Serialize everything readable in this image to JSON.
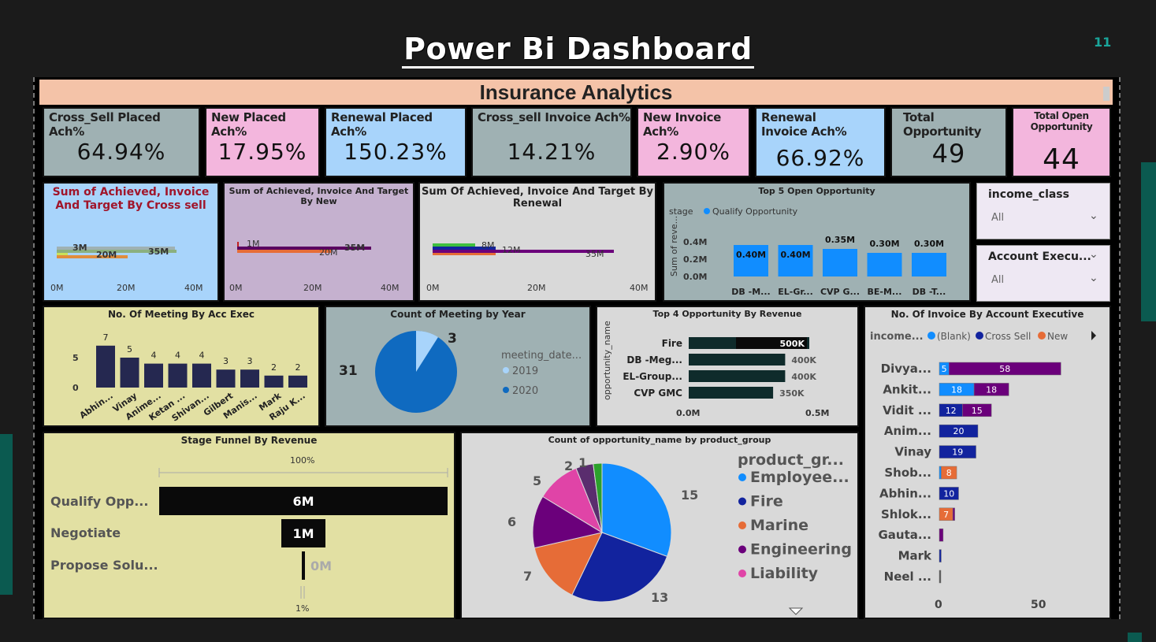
{
  "slide": {
    "title": "Power Bi Dashboard",
    "page_number": "11"
  },
  "header": {
    "title": "Insurance Analytics"
  },
  "kpis": [
    {
      "label": "Cross_Sell Placed Ach%",
      "value": "64.94%",
      "color": "#9fb1b3"
    },
    {
      "label": "New Placed Ach%",
      "value": "17.95%",
      "color": "#f3b6dd"
    },
    {
      "label": "Renewal Placed Ach%",
      "value": "150.23%",
      "color": "#a8d4fb"
    },
    {
      "label": "Cross_sell Invoice Ach%",
      "value": "14.21%",
      "color": "#9fb1b3"
    },
    {
      "label": "New Invoice Ach%",
      "value": "2.90%",
      "color": "#f3b6dd"
    },
    {
      "label": "Renewal Invoice Ach%",
      "value": "66.92%",
      "color": "#a8d4fb"
    },
    {
      "label": "Total Opportunity",
      "value": "49",
      "color": "#9fb1b3"
    },
    {
      "label": "Total Open Opportunity",
      "value": "44",
      "color": "#f3b6dd"
    }
  ],
  "charts": {
    "cross_sell": {
      "title": "Sum of Achieved, Invoice And Target By Cross sell",
      "bar_labels": [
        "3M",
        "20M",
        "35M"
      ],
      "axis": [
        "0M",
        "20M",
        "40M"
      ]
    },
    "new": {
      "title": "Sum of Achieved, Invoice And Target By New",
      "bar_labels": [
        "1M",
        "20M",
        "35M"
      ],
      "axis": [
        "0M",
        "20M",
        "40M"
      ]
    },
    "renewal": {
      "title": "Sum Of Achieved, Invoice And Target By Renewal",
      "bar_labels": [
        "8M",
        "12M",
        "35M"
      ],
      "axis": [
        "0M",
        "20M",
        "40M"
      ]
    },
    "top5": {
      "title": "Top 5 Open Opportunity",
      "legend_label": "stage",
      "legend_item": "Qualify Opportunity",
      "y_axis_title": "Sum of reve...",
      "y_ticks": [
        "0.4M",
        "0.2M",
        "0.0M"
      ],
      "categories": [
        "DB -M...",
        "EL-Gr...",
        "CVP G...",
        "BE-M...",
        "DB -T..."
      ],
      "labels": [
        "0.40M",
        "0.40M",
        "0.35M",
        "0.30M",
        "0.30M"
      ]
    },
    "meetings_exec": {
      "title": "No. Of Meeting By Acc Exec",
      "y_ticks": [
        "5",
        "0"
      ],
      "categories": [
        "Abhin...",
        "Vinay",
        "Anime...",
        "Ketan ...",
        "Shivan...",
        "Gilbert",
        "Manis...",
        "Mark",
        "Raju K..."
      ],
      "labels": [
        "7",
        "5",
        "4",
        "4",
        "4",
        "3",
        "3",
        "2",
        "2"
      ]
    },
    "meetings_year": {
      "title": "Count of Meeting by Year",
      "legend_title": "meeting_date...",
      "legend": [
        "2019",
        "2020"
      ],
      "labels": [
        "3",
        "31"
      ]
    },
    "top4": {
      "title": "Top 4 Opportunity By Revenue",
      "y_axis_title": "opportunity_name",
      "categories": [
        "Fire",
        "DB -Meg...",
        "EL-Group...",
        "CVP GMC"
      ],
      "labels": [
        "500K",
        "400K",
        "400K",
        "350K"
      ],
      "axis": [
        "0.0M",
        "0.5M"
      ]
    },
    "invoice_exec": {
      "title": "No. Of Invoice By Account Executive",
      "legend_title": "income...",
      "legend": [
        "(Blank)",
        "Cross Sell",
        "New"
      ],
      "categories": [
        "Divya...",
        "Ankit...",
        "Vidit ...",
        "Anim...",
        "Vinay",
        "Shob...",
        "Abhin...",
        "Shlok...",
        "Gauta...",
        "Mark",
        "Neel ..."
      ],
      "axis": [
        "0",
        "50"
      ],
      "segment_labels": [
        "5",
        "58",
        "18",
        "18",
        "12",
        "15",
        "20",
        "19",
        "8",
        "10",
        "7"
      ]
    },
    "funnel": {
      "title": "Stage Funnel By Revenue",
      "top_pct": "100%",
      "bottom_pct": "1%",
      "stages": [
        "Qualify Opp...",
        "Negotiate",
        "Propose Solu..."
      ],
      "labels": [
        "6M",
        "1M",
        "0M"
      ]
    },
    "product_pie": {
      "title": "Count of opportunity_name by product_group",
      "legend_title": "product_gr...",
      "legend": [
        "Employee...",
        "Fire",
        "Marine",
        "Engineering",
        "Liability"
      ],
      "labels": [
        "15",
        "13",
        "7",
        "6",
        "5",
        "2",
        "1"
      ]
    }
  },
  "slicers": {
    "income": {
      "label": "income_class",
      "value": "All"
    },
    "account": {
      "label": "Account Execu...",
      "value": "All"
    }
  },
  "colors": {
    "blue": "#118dff",
    "navy": "#12239e",
    "orange": "#e66c37",
    "purple": "#6b007b",
    "pink": "#e044a7",
    "dark_teal": "#0f2b2b"
  }
}
